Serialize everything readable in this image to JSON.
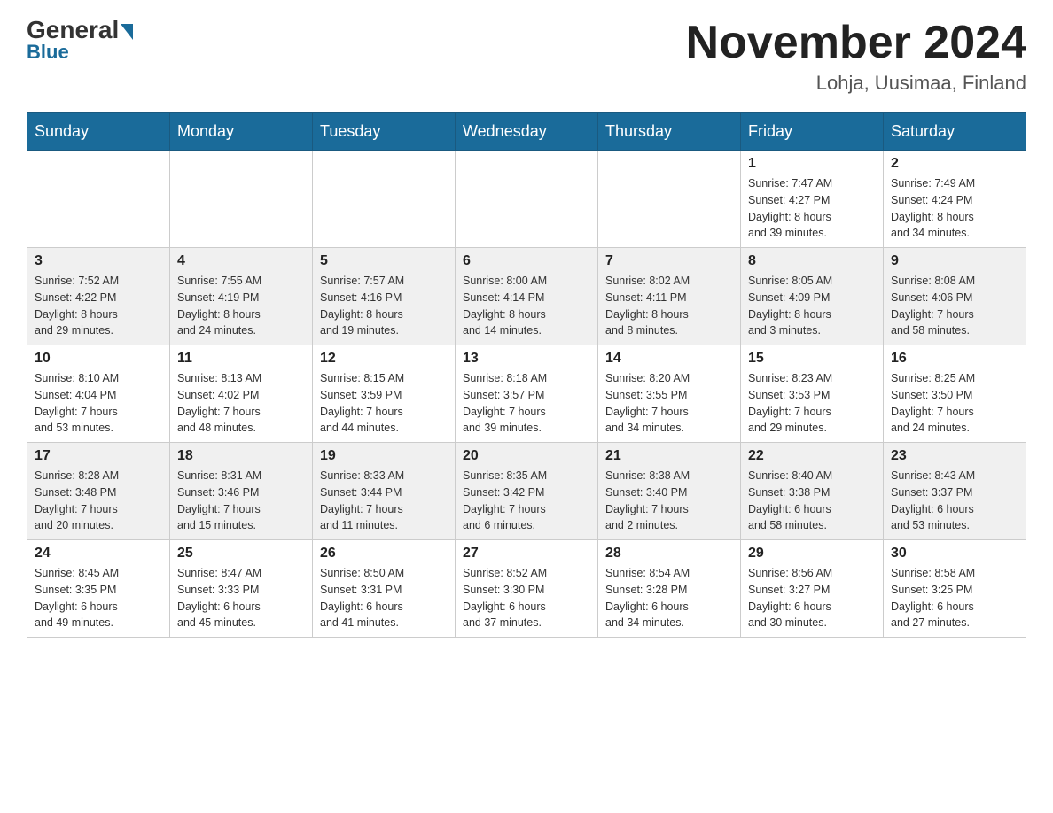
{
  "logo": {
    "text1": "General",
    "text2": "Blue"
  },
  "header": {
    "month_year": "November 2024",
    "location": "Lohja, Uusimaa, Finland"
  },
  "weekdays": [
    "Sunday",
    "Monday",
    "Tuesday",
    "Wednesday",
    "Thursday",
    "Friday",
    "Saturday"
  ],
  "weeks": [
    [
      {
        "day": "",
        "info": ""
      },
      {
        "day": "",
        "info": ""
      },
      {
        "day": "",
        "info": ""
      },
      {
        "day": "",
        "info": ""
      },
      {
        "day": "",
        "info": ""
      },
      {
        "day": "1",
        "info": "Sunrise: 7:47 AM\nSunset: 4:27 PM\nDaylight: 8 hours\nand 39 minutes."
      },
      {
        "day": "2",
        "info": "Sunrise: 7:49 AM\nSunset: 4:24 PM\nDaylight: 8 hours\nand 34 minutes."
      }
    ],
    [
      {
        "day": "3",
        "info": "Sunrise: 7:52 AM\nSunset: 4:22 PM\nDaylight: 8 hours\nand 29 minutes."
      },
      {
        "day": "4",
        "info": "Sunrise: 7:55 AM\nSunset: 4:19 PM\nDaylight: 8 hours\nand 24 minutes."
      },
      {
        "day": "5",
        "info": "Sunrise: 7:57 AM\nSunset: 4:16 PM\nDaylight: 8 hours\nand 19 minutes."
      },
      {
        "day": "6",
        "info": "Sunrise: 8:00 AM\nSunset: 4:14 PM\nDaylight: 8 hours\nand 14 minutes."
      },
      {
        "day": "7",
        "info": "Sunrise: 8:02 AM\nSunset: 4:11 PM\nDaylight: 8 hours\nand 8 minutes."
      },
      {
        "day": "8",
        "info": "Sunrise: 8:05 AM\nSunset: 4:09 PM\nDaylight: 8 hours\nand 3 minutes."
      },
      {
        "day": "9",
        "info": "Sunrise: 8:08 AM\nSunset: 4:06 PM\nDaylight: 7 hours\nand 58 minutes."
      }
    ],
    [
      {
        "day": "10",
        "info": "Sunrise: 8:10 AM\nSunset: 4:04 PM\nDaylight: 7 hours\nand 53 minutes."
      },
      {
        "day": "11",
        "info": "Sunrise: 8:13 AM\nSunset: 4:02 PM\nDaylight: 7 hours\nand 48 minutes."
      },
      {
        "day": "12",
        "info": "Sunrise: 8:15 AM\nSunset: 3:59 PM\nDaylight: 7 hours\nand 44 minutes."
      },
      {
        "day": "13",
        "info": "Sunrise: 8:18 AM\nSunset: 3:57 PM\nDaylight: 7 hours\nand 39 minutes."
      },
      {
        "day": "14",
        "info": "Sunrise: 8:20 AM\nSunset: 3:55 PM\nDaylight: 7 hours\nand 34 minutes."
      },
      {
        "day": "15",
        "info": "Sunrise: 8:23 AM\nSunset: 3:53 PM\nDaylight: 7 hours\nand 29 minutes."
      },
      {
        "day": "16",
        "info": "Sunrise: 8:25 AM\nSunset: 3:50 PM\nDaylight: 7 hours\nand 24 minutes."
      }
    ],
    [
      {
        "day": "17",
        "info": "Sunrise: 8:28 AM\nSunset: 3:48 PM\nDaylight: 7 hours\nand 20 minutes."
      },
      {
        "day": "18",
        "info": "Sunrise: 8:31 AM\nSunset: 3:46 PM\nDaylight: 7 hours\nand 15 minutes."
      },
      {
        "day": "19",
        "info": "Sunrise: 8:33 AM\nSunset: 3:44 PM\nDaylight: 7 hours\nand 11 minutes."
      },
      {
        "day": "20",
        "info": "Sunrise: 8:35 AM\nSunset: 3:42 PM\nDaylight: 7 hours\nand 6 minutes."
      },
      {
        "day": "21",
        "info": "Sunrise: 8:38 AM\nSunset: 3:40 PM\nDaylight: 7 hours\nand 2 minutes."
      },
      {
        "day": "22",
        "info": "Sunrise: 8:40 AM\nSunset: 3:38 PM\nDaylight: 6 hours\nand 58 minutes."
      },
      {
        "day": "23",
        "info": "Sunrise: 8:43 AM\nSunset: 3:37 PM\nDaylight: 6 hours\nand 53 minutes."
      }
    ],
    [
      {
        "day": "24",
        "info": "Sunrise: 8:45 AM\nSunset: 3:35 PM\nDaylight: 6 hours\nand 49 minutes."
      },
      {
        "day": "25",
        "info": "Sunrise: 8:47 AM\nSunset: 3:33 PM\nDaylight: 6 hours\nand 45 minutes."
      },
      {
        "day": "26",
        "info": "Sunrise: 8:50 AM\nSunset: 3:31 PM\nDaylight: 6 hours\nand 41 minutes."
      },
      {
        "day": "27",
        "info": "Sunrise: 8:52 AM\nSunset: 3:30 PM\nDaylight: 6 hours\nand 37 minutes."
      },
      {
        "day": "28",
        "info": "Sunrise: 8:54 AM\nSunset: 3:28 PM\nDaylight: 6 hours\nand 34 minutes."
      },
      {
        "day": "29",
        "info": "Sunrise: 8:56 AM\nSunset: 3:27 PM\nDaylight: 6 hours\nand 30 minutes."
      },
      {
        "day": "30",
        "info": "Sunrise: 8:58 AM\nSunset: 3:25 PM\nDaylight: 6 hours\nand 27 minutes."
      }
    ]
  ]
}
